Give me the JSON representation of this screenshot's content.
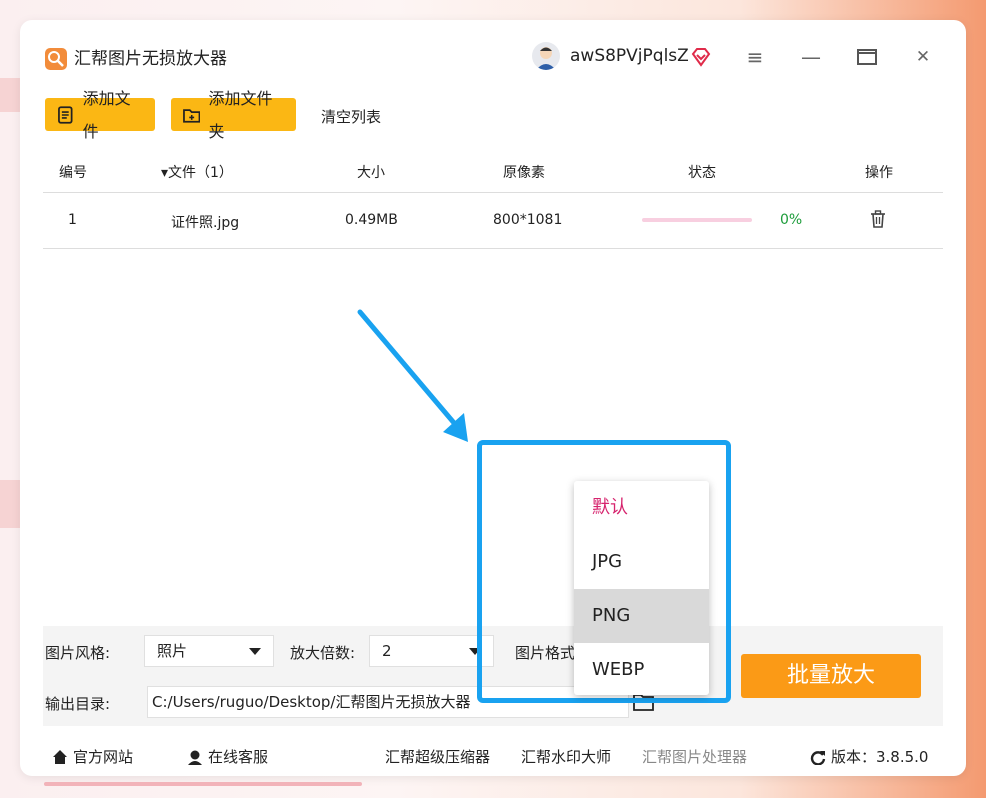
{
  "app": {
    "title": "汇帮图片无损放大器"
  },
  "user": {
    "name": "awS8PVjPqlsZ"
  },
  "window_controls": {
    "menu": "≡",
    "minimize": "—",
    "maximize": "▭",
    "close": "✕"
  },
  "toolbar": {
    "add_file": "添加文件",
    "add_folder": "添加文件夹",
    "clear_list": "清空列表"
  },
  "table": {
    "headers": {
      "index": "编号",
      "file": "▾文件（1）",
      "size": "大小",
      "pixels": "原像素",
      "status": "状态",
      "action": "操作"
    },
    "rows": [
      {
        "index": "1",
        "file": "证件照.jpg",
        "size": "0.49MB",
        "pixels": "800*1081",
        "progress": 0,
        "percent": "0%"
      }
    ]
  },
  "settings": {
    "style_label": "图片风格:",
    "style_value": "照片",
    "scale_label": "放大倍数:",
    "scale_value": "2",
    "format_label": "图片格式:",
    "output_label": "输出目录:",
    "output_value": "C:/Users/ruguo/Desktop/汇帮图片无损放大器"
  },
  "format_dropdown": {
    "options": [
      "默认",
      "JPG",
      "PNG",
      "WEBP"
    ],
    "selected": "默认",
    "hovered": "PNG"
  },
  "action": {
    "batch_enlarge": "批量放大"
  },
  "footer": {
    "website": "官方网站",
    "support": "在线客服",
    "compressor": "汇帮超级压缩器",
    "watermark": "汇帮水印大师",
    "processor": "汇帮图片处理器",
    "version": "版本：3.8.5.0"
  },
  "colors": {
    "accent_yellow": "#fbb714",
    "action_orange": "#fb9a16",
    "highlight_blue": "#19a2f0",
    "selected_pink": "#d6246e",
    "progress_green": "#1c9c3a"
  }
}
